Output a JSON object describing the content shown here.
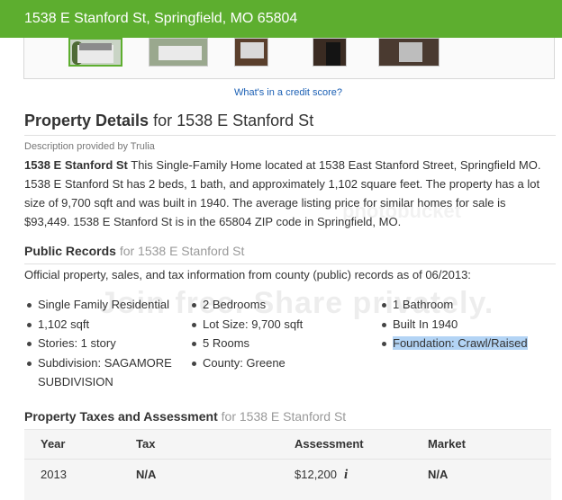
{
  "header": {
    "address_title": "1538 E Stanford St, Springfield, MO 65804"
  },
  "gallery": {
    "thumb_count": 5,
    "active_index": 0
  },
  "credit_link": "What's in a credit score?",
  "property_details": {
    "title": "Property Details",
    "title_sub": "for 1538 E Stanford St",
    "credit": "Description provided by Trulia",
    "lead": "1538 E Stanford St",
    "description": " This Single-Family Home located at 1538 East Stanford Street, Springfield MO. 1538 E Stanford St has 2 beds, 1 bath, and approximately 1,102 square feet. The property has a lot size of 9,700 sqft and was built in 1940. The average listing price for similar homes for sale is $93,449. 1538 E Stanford St is in the 65804 ZIP code in Springfield, MO."
  },
  "public_records": {
    "title": "Public Records",
    "title_sub": "for 1538 E Stanford St",
    "intro": "Official property, sales, and tax information from county (public) records as of 06/2013:",
    "col1": [
      "Single Family Residential",
      "1,102 sqft",
      "Stories: 1 story",
      "Subdivision: SAGAMORE SUBDIVISION"
    ],
    "col2": [
      "2 Bedrooms",
      "Lot Size: 9,700 sqft",
      "5 Rooms",
      "County: Greene"
    ],
    "col3": [
      "1 Bathroom",
      "Built In 1940",
      "Foundation: Crawl/Raised"
    ]
  },
  "watermark": {
    "line1": "Join free. Share privately.",
    "line2": "photobucket"
  },
  "taxes": {
    "title": "Property Taxes and Assessment",
    "title_sub": "for 1538 E Stanford St",
    "headers": [
      "Year",
      "Tax",
      "Assessment",
      "Market"
    ],
    "rows": [
      {
        "year": "2013",
        "tax": "N/A",
        "assessment": "$12,200",
        "market": "N/A"
      }
    ],
    "info_glyph": "i"
  },
  "colors": {
    "brand_green": "#5dae2f",
    "link_blue": "#1a5fb4",
    "highlight": "#b3d4f5"
  }
}
